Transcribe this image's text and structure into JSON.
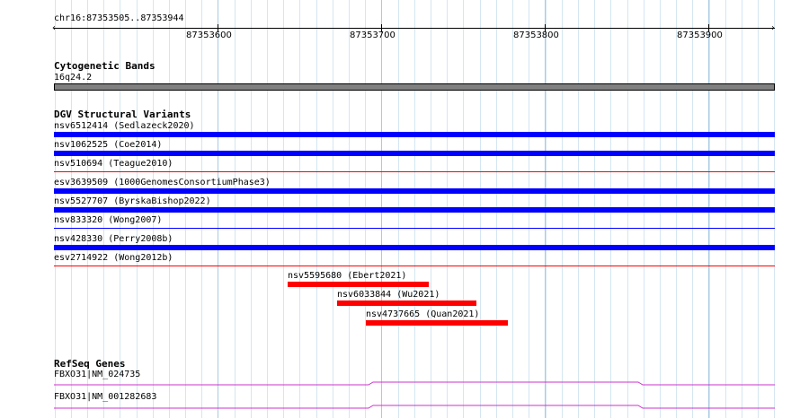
{
  "ruler": {
    "location": "chr16:87353505..87353944",
    "ticks": [
      "87353600",
      "87353700",
      "87353800",
      "87353900"
    ]
  },
  "cytoband": {
    "title": "Cytogenetic Bands",
    "band": "16q24.2",
    "color": "#808080"
  },
  "dgv": {
    "title": "DGV Structural Variants",
    "variants": [
      {
        "label": "nsv6512414 (Sedlazeck2020)",
        "color": "#0000ff",
        "type": "bar"
      },
      {
        "label": "nsv1062525 (Coe2014)",
        "color": "#0000ff",
        "type": "bar"
      },
      {
        "label": "nsv510694 (Teague2010)",
        "color": "#ff0000",
        "type": "line"
      },
      {
        "label": "esv3639509 (1000GenomesConsortiumPhase3)",
        "color": "#0000ff",
        "type": "bar"
      },
      {
        "label": "nsv5527707 (ByrskaBishop2022)",
        "color": "#0000ff",
        "type": "bar"
      },
      {
        "label": "nsv833320 (Wong2007)",
        "color": "#0000ff",
        "type": "line"
      },
      {
        "label": "nsv428330 (Perry2008b)",
        "color": "#0000ff",
        "type": "bar"
      },
      {
        "label": "esv2714922 (Wong2012b)",
        "color": "#ff0000",
        "type": "line"
      }
    ],
    "short_variants": [
      {
        "label": "nsv5595680 (Ebert2021)",
        "color": "#ff0000"
      },
      {
        "label": "nsv6033844 (Wu2021)",
        "color": "#ff0000"
      },
      {
        "label": "nsv4737665 (Quan2021)",
        "color": "#ff0000"
      }
    ]
  },
  "refseq": {
    "title": "RefSeq Genes",
    "genes": [
      {
        "label": "FBXO31|NM_024735",
        "color": "#cc33cc"
      },
      {
        "label": "FBXO31|NM_001282683",
        "color": "#cc33cc"
      }
    ]
  }
}
